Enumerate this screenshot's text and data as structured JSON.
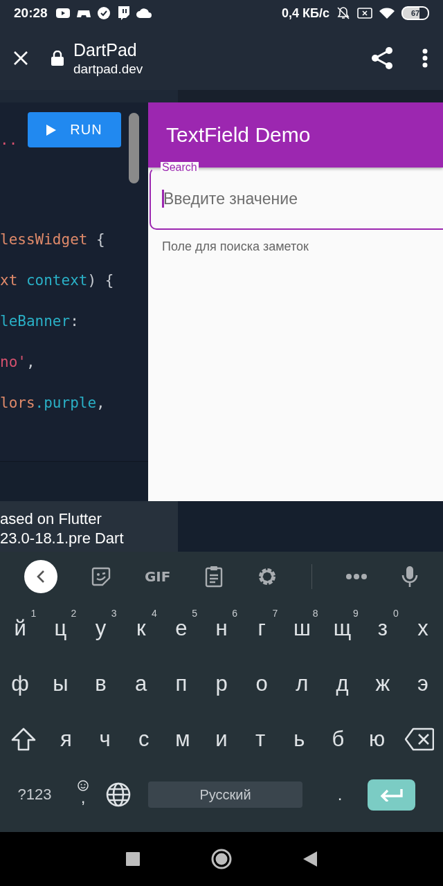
{
  "status_bar": {
    "time": "20:28",
    "speed": "0,4 КБ/с",
    "battery": "67"
  },
  "browser_toolbar": {
    "title": "DartPad",
    "url": "dartpad.dev"
  },
  "editor": {
    "run_button": "RUN",
    "first_lines": [
      {
        "tokens": [
          {
            "text": "..",
            "kind": "string"
          }
        ]
      }
    ],
    "lines": [
      {
        "tokens": [
          {
            "text": "lessWidget",
            "kind": "type"
          },
          {
            "text": " {",
            "kind": "punct"
          }
        ]
      },
      {
        "tokens": [
          {
            "text": "xt",
            "kind": "type"
          },
          {
            "text": " context",
            "kind": "ident"
          },
          {
            "text": ") {",
            "kind": "punct"
          }
        ]
      },
      {
        "tokens": [
          {
            "text": "leBanner",
            "kind": "ident"
          },
          {
            "text": ":",
            "kind": "punct"
          }
        ]
      },
      {
        "tokens": [
          {
            "text": "no'",
            "kind": "string"
          },
          {
            "text": ",",
            "kind": "punct"
          }
        ]
      },
      {
        "tokens": [
          {
            "text": "lors",
            "kind": "type"
          },
          {
            "text": ".purple",
            "kind": "ident"
          },
          {
            "text": ",",
            "kind": "punct"
          }
        ]
      }
    ]
  },
  "preview": {
    "app_bar_title": "TextField Demo",
    "field": {
      "label": "Search",
      "placeholder": "Введите значение",
      "focused": true
    },
    "helper_text": "Поле для поиска заметок"
  },
  "console": {
    "lines": [
      "ased on Flutter",
      "23.0-18.1.pre Dart"
    ]
  },
  "keyboard": {
    "toolbar": [
      {
        "kind": "back"
      },
      {
        "kind": "sticker"
      },
      {
        "kind": "gif",
        "label": "GIF"
      },
      {
        "kind": "clipboard"
      },
      {
        "kind": "settings"
      },
      {
        "kind": "divider"
      },
      {
        "kind": "more"
      },
      {
        "kind": "mic"
      }
    ],
    "rows": [
      {
        "keys": [
          {
            "kind": "letter",
            "label": "й",
            "hint": "1"
          },
          {
            "kind": "letter",
            "label": "ц",
            "hint": "2"
          },
          {
            "kind": "letter",
            "label": "у",
            "hint": "3"
          },
          {
            "kind": "letter",
            "label": "к",
            "hint": "4"
          },
          {
            "kind": "letter",
            "label": "е",
            "hint": "5"
          },
          {
            "kind": "letter",
            "label": "н",
            "hint": "6"
          },
          {
            "kind": "letter",
            "label": "г",
            "hint": "7"
          },
          {
            "kind": "letter",
            "label": "ш",
            "hint": "8"
          },
          {
            "kind": "letter",
            "label": "щ",
            "hint": "9"
          },
          {
            "kind": "letter",
            "label": "з",
            "hint": "0"
          },
          {
            "kind": "letter",
            "label": "х"
          }
        ]
      },
      {
        "keys": [
          {
            "kind": "letter",
            "label": "ф"
          },
          {
            "kind": "letter",
            "label": "ы"
          },
          {
            "kind": "letter",
            "label": "в"
          },
          {
            "kind": "letter",
            "label": "а"
          },
          {
            "kind": "letter",
            "label": "п"
          },
          {
            "kind": "letter",
            "label": "р"
          },
          {
            "kind": "letter",
            "label": "о"
          },
          {
            "kind": "letter",
            "label": "л"
          },
          {
            "kind": "letter",
            "label": "д"
          },
          {
            "kind": "letter",
            "label": "ж"
          },
          {
            "kind": "letter",
            "label": "э"
          }
        ]
      },
      {
        "keys": [
          {
            "kind": "shift"
          },
          {
            "kind": "letter",
            "label": "я"
          },
          {
            "kind": "letter",
            "label": "ч"
          },
          {
            "kind": "letter",
            "label": "с"
          },
          {
            "kind": "letter",
            "label": "м"
          },
          {
            "kind": "letter",
            "label": "и"
          },
          {
            "kind": "letter",
            "label": "т"
          },
          {
            "kind": "letter",
            "label": "ь"
          },
          {
            "kind": "letter",
            "label": "б"
          },
          {
            "kind": "letter",
            "label": "ю"
          },
          {
            "kind": "backspace"
          }
        ]
      },
      {
        "keys": [
          {
            "kind": "symbols",
            "label": "?123"
          },
          {
            "kind": "emoji_comma",
            "label": ","
          },
          {
            "kind": "globe"
          },
          {
            "kind": "space",
            "label": "Русский"
          },
          {
            "kind": "period",
            "label": "."
          },
          {
            "kind": "enter"
          }
        ]
      }
    ]
  }
}
